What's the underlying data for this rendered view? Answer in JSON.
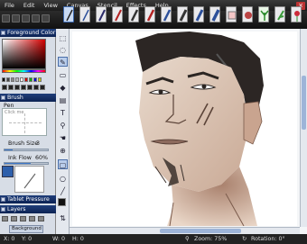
{
  "menu": [
    "File",
    "Edit",
    "View",
    "Canvas",
    "Stencil",
    "Effects",
    "Help"
  ],
  "window": {
    "close_label": "×"
  },
  "panels": {
    "foreground_color": "Foreground Color",
    "brush": "Brush",
    "brush_type": "Pen",
    "brush_preview": "Click me",
    "brush_size_label": "Brush Size",
    "brush_size_value": "3",
    "ink_flow_label": "Ink Flow",
    "ink_flow_value": "60%",
    "ink_flow_level": 0.6,
    "brush_size_level": 0.18,
    "tablet_pressure": "Tablet Pressure",
    "layers": "Layers",
    "layer_name": "Background"
  },
  "status": {
    "x": "X: 0",
    "y": "Y: 0",
    "w": "W: 0",
    "h": "H: 0",
    "zoom": "Zoom: 75%",
    "rotation": "Rotation: 0°"
  },
  "icons": [
    "pen-icon",
    "brush-icon",
    "airbrush-icon",
    "marker-icon",
    "eraser-icon",
    "smudge-icon",
    "select-icon",
    "zoom-icon",
    "hand-icon",
    "rotate-icon",
    "eyedropper-icon",
    "fill-icon"
  ]
}
